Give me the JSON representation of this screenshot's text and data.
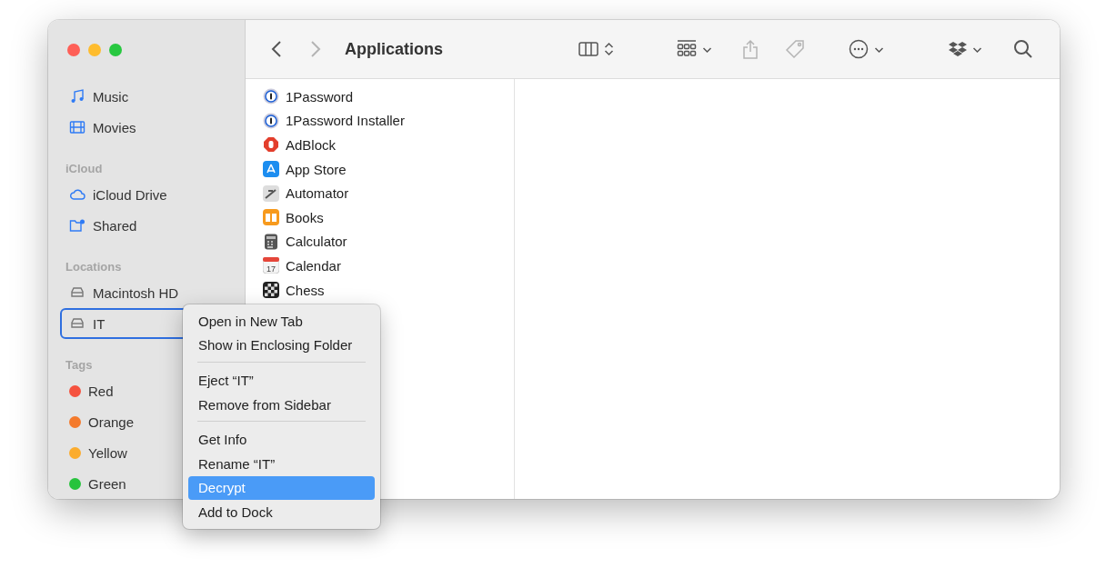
{
  "window": {
    "title": "Applications"
  },
  "navigation": [
    {
      "kind": "back",
      "disabled": false
    },
    {
      "kind": "forward",
      "disabled": true
    }
  ],
  "toolbar": [
    {
      "kind": "columns",
      "disabled": false
    },
    {
      "kind": "group",
      "disabled": false
    },
    {
      "kind": "share",
      "disabled": true
    },
    {
      "kind": "tag",
      "disabled": true
    },
    {
      "kind": "more",
      "disabled": false
    },
    {
      "kind": "dropbox",
      "disabled": false
    },
    {
      "kind": "search",
      "disabled": false
    }
  ],
  "sidebar": {
    "sections": [
      {
        "items": [
          {
            "label": "Music",
            "kind": "music",
            "selected": false
          },
          {
            "label": "Movies",
            "kind": "movies",
            "selected": false
          }
        ]
      },
      {
        "heading": "iCloud",
        "items": [
          {
            "label": "iCloud Drive",
            "kind": "cloud",
            "selected": false
          },
          {
            "label": "Shared",
            "kind": "shared",
            "selected": false
          }
        ]
      },
      {
        "heading": "Locations",
        "items": [
          {
            "label": "Macintosh HD",
            "kind": "disk",
            "selected": false
          },
          {
            "label": "IT",
            "kind": "disk",
            "selected": true
          }
        ]
      },
      {
        "heading": "Tags",
        "items": [
          {
            "label": "Red",
            "kind": "tag",
            "color": "#f5523f",
            "selected": false
          },
          {
            "label": "Orange",
            "kind": "tag",
            "color": "#f47a2c",
            "selected": false
          },
          {
            "label": "Yellow",
            "kind": "tag",
            "color": "#fbac2d",
            "selected": false
          },
          {
            "label": "Green",
            "kind": "tag",
            "color": "#27c33d",
            "selected": false
          }
        ]
      }
    ]
  },
  "files": [
    {
      "name": "1Password",
      "kind": "password"
    },
    {
      "name": "1Password Installer",
      "kind": "password"
    },
    {
      "name": "AdBlock",
      "kind": "adblock"
    },
    {
      "name": "App Store",
      "kind": "appstore"
    },
    {
      "name": "Automator",
      "kind": "automator"
    },
    {
      "name": "Books",
      "kind": "books"
    },
    {
      "name": "Calculator",
      "kind": "calculator"
    },
    {
      "name": "Calendar",
      "kind": "calendar",
      "badge": "17"
    },
    {
      "name": "Chess",
      "kind": "chess"
    }
  ],
  "context_menu": {
    "groups": [
      [
        {
          "label": "Open in New Tab",
          "selected": false
        },
        {
          "label": "Show in Enclosing Folder",
          "selected": false
        }
      ],
      [
        {
          "label": "Eject “IT”",
          "selected": false
        },
        {
          "label": "Remove from Sidebar",
          "selected": false
        }
      ],
      [
        {
          "label": "Get Info",
          "selected": false
        },
        {
          "label": "Rename “IT”",
          "selected": false
        },
        {
          "label": "Decrypt",
          "selected": true
        },
        {
          "label": "Add to Dock",
          "selected": false
        }
      ]
    ]
  }
}
